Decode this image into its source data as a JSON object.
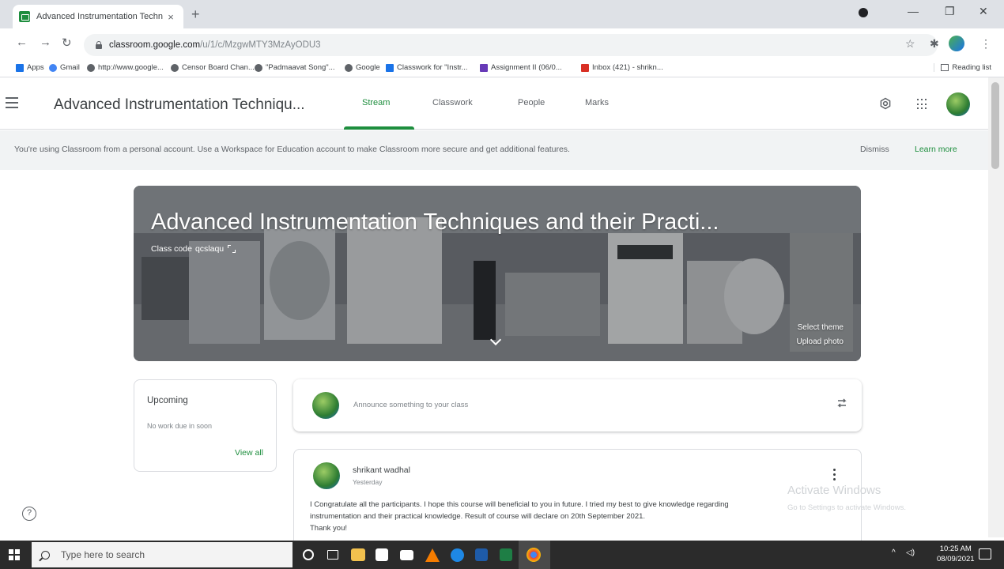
{
  "browser": {
    "tab_title": "Advanced Instrumentation Techn",
    "tab_close": "×",
    "new_tab": "+",
    "url_host": "classroom.google.com",
    "url_path": "/u/1/c/MzgwMTY3MzAyODU3",
    "bookmarks": [
      "Apps",
      "Gmail",
      "http://www.google...",
      "Censor Board Chan...",
      "\"Padmaavat Song\"...",
      "Google",
      "Classwork for \"Instr...",
      "Assignment II (06/0...",
      "Inbox (421) - shrikn..."
    ],
    "reading_list": "Reading list"
  },
  "header": {
    "class_title": "Advanced Instrumentation Techniqu...",
    "tabs": [
      "Stream",
      "Classwork",
      "People",
      "Marks"
    ],
    "active_tab": "Stream"
  },
  "banner": {
    "text": "You're using Classroom from a personal account. Use a Workspace for Education account to make Classroom more secure and get additional features.",
    "dismiss": "Dismiss",
    "learn_more": "Learn more"
  },
  "hero": {
    "title": "Advanced Instrumentation Techniques and their Practi...",
    "class_code_label": "Class code",
    "class_code": "qcslaqu",
    "select_theme": "Select theme",
    "upload_photo": "Upload photo"
  },
  "upcoming": {
    "title": "Upcoming",
    "empty": "No work due in soon",
    "view_all": "View all"
  },
  "announce": {
    "placeholder": "Announce something to your class"
  },
  "post": {
    "author": "shrikant wadhal",
    "date": "Yesterday",
    "body_line1": "I Congratulate all the participants. I hope this course will beneficial to you in future. I tried my best to give knowledge regarding",
    "body_line2": "instrumentation and their practical knowledge. Result of course will declare on 20th September 2021.",
    "body_line3": "Thank you!"
  },
  "watermark": {
    "title": "Activate Windows",
    "subtitle": "Go to Settings to activate Windows."
  },
  "taskbar": {
    "search_placeholder": "Type here to search",
    "time": "10:25 AM",
    "date": "08/09/2021"
  },
  "colors": {
    "accent": "#1e8e3e",
    "text": "#3c4043",
    "banner_bg": "#f1f3f4",
    "taskbar_bg": "#2b2b2b"
  }
}
